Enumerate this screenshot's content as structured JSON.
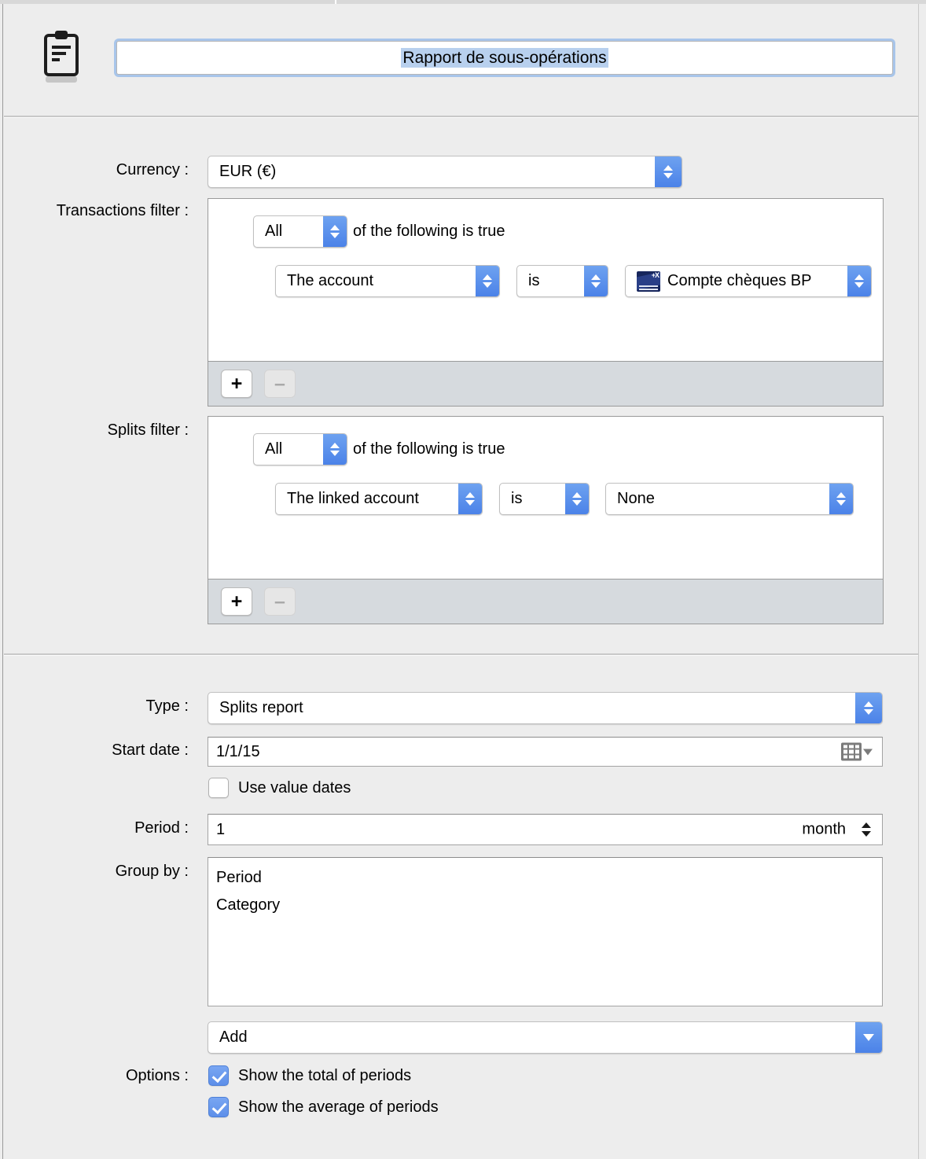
{
  "window": {
    "title_field": {
      "value": "Rapport de sous-opérations",
      "icon": "clipboard-report-icon"
    }
  },
  "filters_section": {
    "currency": {
      "label": "Currency :",
      "value": "EUR (€)"
    },
    "transactions_filter": {
      "label": "Transactions filter :",
      "match": {
        "value": "All",
        "suffix": "of the following is true"
      },
      "rules": [
        {
          "field": "The account",
          "operator": "is",
          "value": "Compte chèques BP",
          "value_icon": "banque-populaire-logo-icon"
        }
      ],
      "add_button": "+",
      "remove_button": "–"
    },
    "splits_filter": {
      "label": "Splits filter :",
      "match": {
        "value": "All",
        "suffix": "of the following is true"
      },
      "rules": [
        {
          "field": "The linked account",
          "operator": "is",
          "value": "None"
        }
      ],
      "add_button": "+",
      "remove_button": "–"
    }
  },
  "settings_section": {
    "type": {
      "label": "Type :",
      "value": "Splits report"
    },
    "start_date": {
      "label": "Start date :",
      "value": "1/1/15",
      "icon": "calendar-picker-icon"
    },
    "use_value_dates": {
      "label": "Use value dates",
      "checked": false
    },
    "period": {
      "label": "Period :",
      "value": "1",
      "unit": "month"
    },
    "group_by": {
      "label": "Group by :",
      "items": [
        "Period",
        "Category"
      ],
      "add_dropdown": "Add"
    },
    "options": {
      "label": "Options :",
      "items": [
        {
          "label": "Show the total of periods",
          "checked": true
        },
        {
          "label": "Show the average of periods",
          "checked": true
        }
      ]
    }
  },
  "colors": {
    "accent_blue": "#4b82e8",
    "selection_blue": "#b8d0ee",
    "focus_ring": "#a8c5ea",
    "window_bg": "#ededed"
  }
}
